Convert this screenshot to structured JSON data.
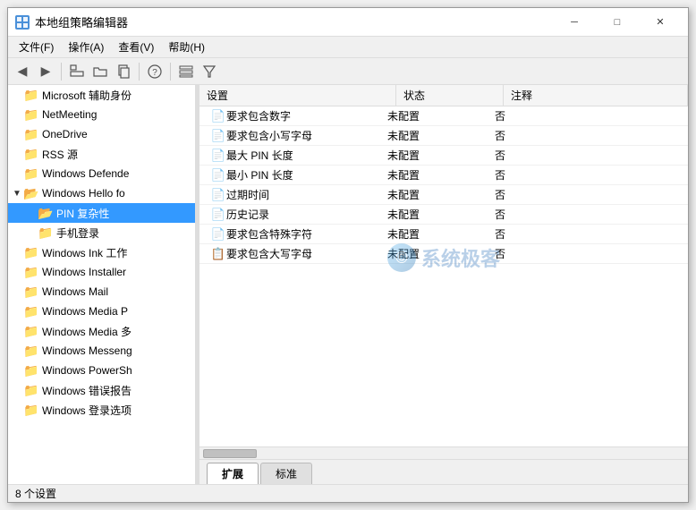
{
  "window": {
    "title": "本地组策略编辑器",
    "controls": {
      "minimize": "─",
      "maximize": "□",
      "close": "✕"
    }
  },
  "menu": {
    "items": [
      "文件(F)",
      "操作(A)",
      "查看(V)",
      "帮助(H)"
    ]
  },
  "toolbar": {
    "buttons": [
      "◀",
      "▶",
      "⬆",
      "📋",
      "📄",
      "🔍",
      "?",
      "📊",
      "🔽"
    ]
  },
  "left_pane": {
    "items": [
      {
        "label": "Microsoft 辅助身份",
        "indent": 0,
        "has_arrow": false,
        "expanded": false,
        "open": false
      },
      {
        "label": "NetMeeting",
        "indent": 0,
        "has_arrow": false,
        "expanded": false,
        "open": false
      },
      {
        "label": "OneDrive",
        "indent": 0,
        "has_arrow": false,
        "expanded": false,
        "open": false
      },
      {
        "label": "RSS 源",
        "indent": 0,
        "has_arrow": false,
        "expanded": false,
        "open": false
      },
      {
        "label": "Windows Defende",
        "indent": 0,
        "has_arrow": false,
        "expanded": false,
        "open": false
      },
      {
        "label": "Windows Hello fo",
        "indent": 0,
        "has_arrow": true,
        "expanded": true,
        "open": true
      },
      {
        "label": "PIN 复杂性",
        "indent": 1,
        "has_arrow": false,
        "expanded": false,
        "open": true,
        "selected": true
      },
      {
        "label": "手机登录",
        "indent": 1,
        "has_arrow": false,
        "expanded": false,
        "open": false
      },
      {
        "label": "Windows Ink 工作",
        "indent": 0,
        "has_arrow": false,
        "expanded": false,
        "open": false
      },
      {
        "label": "Windows Installer",
        "indent": 0,
        "has_arrow": false,
        "expanded": false,
        "open": false
      },
      {
        "label": "Windows Mail",
        "indent": 0,
        "has_arrow": false,
        "expanded": false,
        "open": false
      },
      {
        "label": "Windows Media P",
        "indent": 0,
        "has_arrow": false,
        "expanded": false,
        "open": false
      },
      {
        "label": "Windows Media 多",
        "indent": 0,
        "has_arrow": false,
        "expanded": false,
        "open": false
      },
      {
        "label": "Windows Messeng",
        "indent": 0,
        "has_arrow": false,
        "expanded": false,
        "open": false
      },
      {
        "label": "Windows PowerSh",
        "indent": 0,
        "has_arrow": false,
        "expanded": false,
        "open": false
      },
      {
        "label": "Windows 错误报告",
        "indent": 0,
        "has_arrow": false,
        "expanded": false,
        "open": false
      },
      {
        "label": "Windows 登录选项",
        "indent": 0,
        "has_arrow": false,
        "expanded": false,
        "open": false
      }
    ]
  },
  "table": {
    "headers": [
      "设置",
      "状态",
      "注释"
    ],
    "rows": [
      {
        "icon": "📄",
        "setting": "要求包含数字",
        "status": "未配置",
        "note": "否"
      },
      {
        "icon": "📄",
        "setting": "要求包含小写字母",
        "status": "未配置",
        "note": "否"
      },
      {
        "icon": "📄",
        "setting": "最大 PIN 长度",
        "status": "未配置",
        "note": "否"
      },
      {
        "icon": "📄",
        "setting": "最小 PIN 长度",
        "status": "未配置",
        "note": "否"
      },
      {
        "icon": "📄",
        "setting": "过期时间",
        "status": "未配置",
        "note": "否"
      },
      {
        "icon": "📄",
        "setting": "历史记录",
        "status": "未配置",
        "note": "否"
      },
      {
        "icon": "📄",
        "setting": "要求包含特殊字符",
        "status": "未配置",
        "note": "否"
      },
      {
        "icon": "📋",
        "setting": "要求包含大写字母",
        "status": "未配置",
        "note": "否"
      }
    ]
  },
  "tabs": [
    "扩展",
    "标准"
  ],
  "active_tab": "扩展",
  "status_bar": {
    "text": "8 个设置"
  },
  "watermark": {
    "text": "系统极客"
  }
}
